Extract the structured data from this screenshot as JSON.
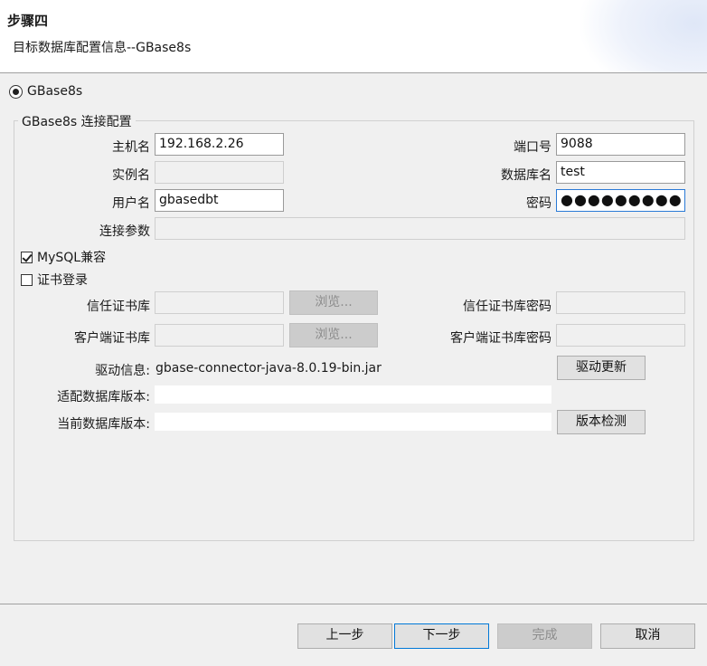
{
  "header": {
    "step_title": "步骤四",
    "subtitle": "目标数据库配置信息--GBase8s"
  },
  "db_option": {
    "label": "GBase8s",
    "selected": true
  },
  "group": {
    "title": "GBase8s 连接配置"
  },
  "fields": {
    "host": {
      "label": "主机名",
      "value": "192.168.2.26"
    },
    "port": {
      "label": "端口号",
      "value": "9088"
    },
    "instance": {
      "label": "实例名",
      "value": ""
    },
    "database": {
      "label": "数据库名",
      "value": "test"
    },
    "username": {
      "label": "用户名",
      "value": "gbasedbt"
    },
    "password": {
      "label": "密码",
      "value": "●●●●●●●●●"
    },
    "params": {
      "label": "连接参数",
      "value": ""
    }
  },
  "checkboxes": {
    "mysql_compat": {
      "label": "MySQL兼容",
      "checked": true
    },
    "cert_login": {
      "label": "证书登录",
      "checked": false
    }
  },
  "cert": {
    "trust_store": {
      "label": "信任证书库",
      "value": ""
    },
    "trust_browse": "浏览...",
    "trust_store_password": {
      "label": "信任证书库密码",
      "value": ""
    },
    "client_store": {
      "label": "客户端证书库",
      "value": ""
    },
    "client_browse": "浏览...",
    "client_store_password": {
      "label": "客户端证书库密码",
      "value": ""
    }
  },
  "driver": {
    "label": "驱动信息:",
    "value": "gbase-connector-java-8.0.19-bin.jar",
    "update_button": "驱动更新"
  },
  "versions": {
    "adapted_label": "适配数据库版本:",
    "adapted_value": "",
    "current_label": "当前数据库版本:",
    "current_value": "",
    "check_button": "版本检测"
  },
  "footer": {
    "prev": "上一步",
    "next": "下一步",
    "finish": "完成",
    "cancel": "取消"
  },
  "colors": {
    "focus": "#2a7ad6",
    "background": "#f0f0f0"
  }
}
